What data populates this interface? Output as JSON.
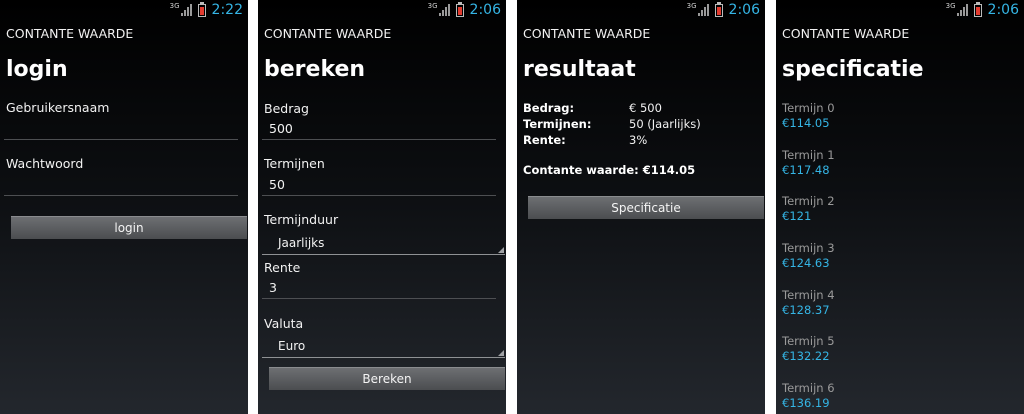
{
  "app_title": "CONTANTE WAARDE",
  "status": {
    "network": "3G",
    "time_login": "2:22",
    "time_other": "2:06"
  },
  "colors": {
    "accent": "#35b5e5",
    "battery": "#e33b2f"
  },
  "login": {
    "heading": "login",
    "username_label": "Gebruikersnaam",
    "username_value": "",
    "password_label": "Wachtwoord",
    "password_value": "",
    "button": "login"
  },
  "bereken": {
    "heading": "bereken",
    "bedrag_label": "Bedrag",
    "bedrag_value": "500",
    "termijnen_label": "Termijnen",
    "termijnen_value": "50",
    "termijnduur_label": "Termijnduur",
    "termijnduur_value": "Jaarlijks",
    "rente_label": "Rente",
    "rente_value": "3",
    "valuta_label": "Valuta",
    "valuta_value": "Euro",
    "button": "Bereken"
  },
  "resultaat": {
    "heading": "resultaat",
    "rows": [
      {
        "label": "Bedrag:",
        "value": "€ 500"
      },
      {
        "label": "Termijnen:",
        "value": "50 (Jaarlijks)"
      },
      {
        "label": "Rente:",
        "value": "3%"
      }
    ],
    "contante_waarde": "Contante waarde: €114.05",
    "button": "Specificatie"
  },
  "specificatie": {
    "heading": "specificatie",
    "items": [
      {
        "term": "Termijn 0",
        "amount": "€114.05"
      },
      {
        "term": "Termijn 1",
        "amount": "€117.48"
      },
      {
        "term": "Termijn 2",
        "amount": "€121"
      },
      {
        "term": "Termijn 3",
        "amount": "€124.63"
      },
      {
        "term": "Termijn 4",
        "amount": "€128.37"
      },
      {
        "term": "Termijn 5",
        "amount": "€132.22"
      },
      {
        "term": "Termijn 6",
        "amount": "€136.19"
      }
    ]
  }
}
